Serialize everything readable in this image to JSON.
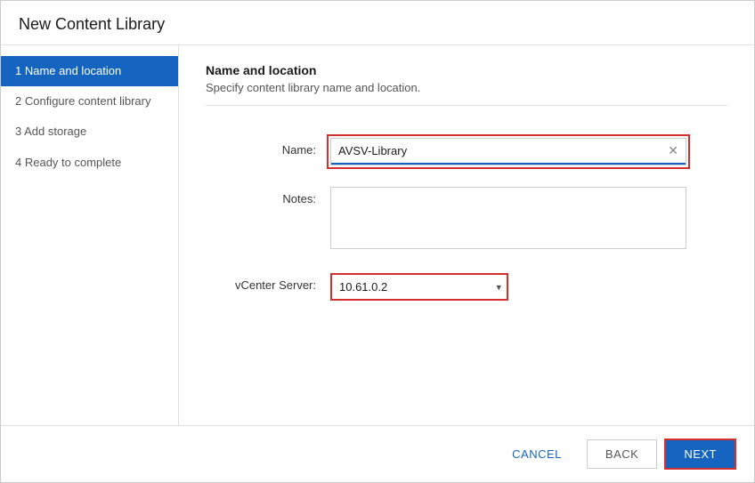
{
  "dialog": {
    "title": "New Content Library"
  },
  "sidebar": {
    "items": [
      {
        "id": "name-location",
        "label": "1 Name and location",
        "active": true
      },
      {
        "id": "configure-content",
        "label": "2 Configure content library",
        "active": false
      },
      {
        "id": "add-storage",
        "label": "3 Add storage",
        "active": false
      },
      {
        "id": "ready-complete",
        "label": "4 Ready to complete",
        "active": false
      }
    ]
  },
  "main": {
    "section_title": "Name and location",
    "section_subtitle": "Specify content library name and location.",
    "form": {
      "name_label": "Name:",
      "name_value": "AVSV-Library",
      "notes_label": "Notes:",
      "notes_value": "",
      "notes_placeholder": "",
      "vcenter_label": "vCenter Server:",
      "vcenter_value": "10.61.0.2",
      "vcenter_options": [
        "10.61.0.2"
      ]
    }
  },
  "footer": {
    "cancel_label": "CANCEL",
    "back_label": "BACK",
    "next_label": "NEXT"
  },
  "icons": {
    "clear": "✕",
    "chevron_down": "▾"
  }
}
